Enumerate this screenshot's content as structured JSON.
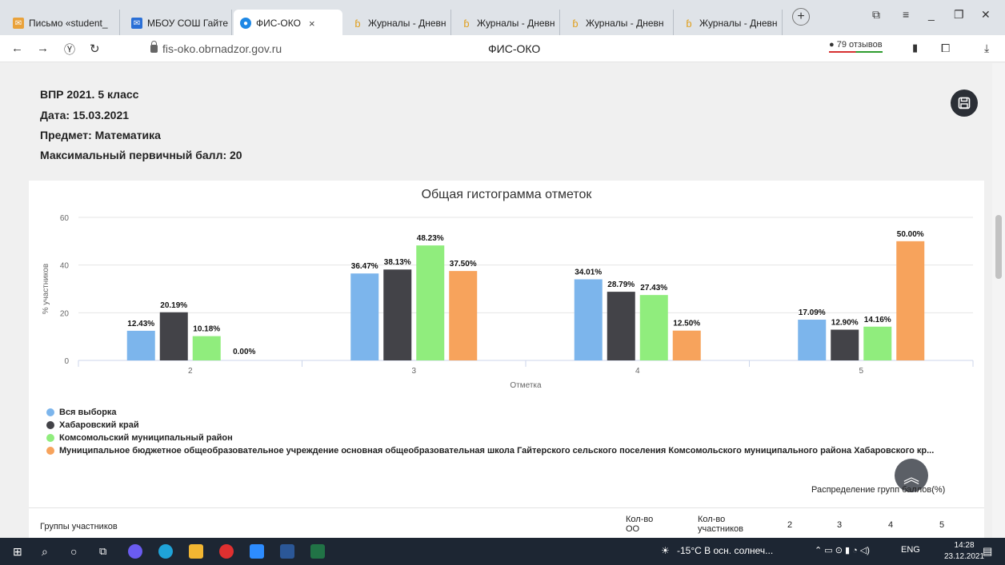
{
  "browser": {
    "tabs": [
      {
        "label": "Письмо «student_",
        "icon": "mail-icon",
        "active": false
      },
      {
        "label": "МБОУ СОШ Гайте",
        "icon": "mail-icon",
        "active": false
      },
      {
        "label": "ФИС-ОКО",
        "icon": "site-icon",
        "active": true
      },
      {
        "label": "Журналы - Дневн",
        "icon": "diary-icon",
        "active": false
      },
      {
        "label": "Журналы - Дневн",
        "icon": "diary-icon",
        "active": false
      },
      {
        "label": "Журналы - Дневн",
        "icon": "diary-icon",
        "active": false
      },
      {
        "label": "Журналы - Дневн",
        "icon": "diary-icon",
        "active": false
      }
    ],
    "active_tab_close": "×",
    "url": "fis-oko.obrnadzor.gov.ru",
    "page_title": "ФИС-ОКО",
    "reviews": "79 отзывов"
  },
  "report": {
    "title": "ВПР 2021. 5 класс",
    "date": "Дата: 15.03.2021",
    "subject": "Предмет: Математика",
    "max_score": "Максимальный первичный балл: 20"
  },
  "chart_data": {
    "type": "bar",
    "title": "Общая гистограмма отметок",
    "xlabel": "Отметка",
    "ylabel": "% участников",
    "ylim": [
      0,
      60
    ],
    "yticks": [
      "0",
      "20",
      "40",
      "60"
    ],
    "categories": [
      "2",
      "3",
      "4",
      "5"
    ],
    "series": [
      {
        "name": "Вся выборка",
        "color": "#7cb5ec",
        "values": [
          12.43,
          36.47,
          34.01,
          17.09
        ],
        "labels": [
          "12.43%",
          "36.47%",
          "34.01%",
          "17.09%"
        ]
      },
      {
        "name": "Хабаровский край",
        "color": "#434348",
        "values": [
          20.19,
          38.13,
          28.79,
          12.9
        ],
        "labels": [
          "20.19%",
          "38.13%",
          "28.79%",
          "12.90%"
        ]
      },
      {
        "name": "Комсомольский муниципальный район",
        "color": "#90ed7d",
        "values": [
          10.18,
          48.23,
          27.43,
          14.16
        ],
        "labels": [
          "10.18%",
          "48.23%",
          "27.43%",
          "14.16%"
        ]
      },
      {
        "name": "Муниципальное бюджетное общеобразовательное учреждение основная общеобразовательная школа Гайтерского сельского поселения Комсомольского муниципального района Хабаровского кр...",
        "color": "#f7a35c",
        "values": [
          0.0,
          37.5,
          12.5,
          50.0
        ],
        "labels": [
          "0.00%",
          "37.50%",
          "12.50%",
          "50.00%"
        ]
      }
    ],
    "legend": "bottom-left",
    "grid": true
  },
  "distribution_label": "Распределение групп баллов(%)",
  "table_header": {
    "groups": "Группы участников",
    "count_oo": "Кол-во\nОО",
    "count_participants": "Кол-во\nучастников",
    "cols": [
      "2",
      "3",
      "4",
      "5"
    ]
  },
  "taskbar": {
    "weather": "-15°C  В осн. солнеч...",
    "lang": "ENG",
    "time": "14:28",
    "date": "23.12.2021"
  }
}
